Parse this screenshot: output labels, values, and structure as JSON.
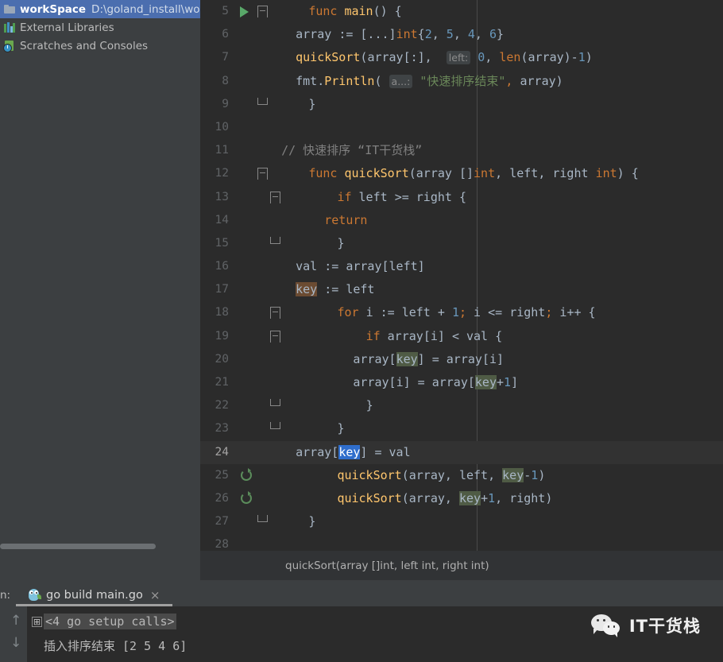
{
  "project_panel": {
    "items": [
      {
        "icon": "folder-icon",
        "label": "workSpace",
        "path": "D:\\goland_install\\wo",
        "selected": true
      },
      {
        "icon": "library-icon",
        "label": "External Libraries",
        "path": "",
        "selected": false
      },
      {
        "icon": "scratches-icon",
        "label": "Scratches and Consoles",
        "path": "",
        "selected": false
      }
    ]
  },
  "editor": {
    "lines": [
      {
        "num": "5",
        "glyph": "run-arrow",
        "fold": "collapse"
      },
      {
        "num": "6",
        "glyph": "",
        "fold": ""
      },
      {
        "num": "7",
        "glyph": "",
        "fold": ""
      },
      {
        "num": "8",
        "glyph": "",
        "fold": ""
      },
      {
        "num": "9",
        "glyph": "",
        "fold": "expand-end"
      },
      {
        "num": "10",
        "glyph": "",
        "fold": ""
      },
      {
        "num": "11",
        "glyph": "",
        "fold": ""
      },
      {
        "num": "12",
        "glyph": "",
        "fold": "collapse"
      },
      {
        "num": "13",
        "glyph": "",
        "fold": "collapse"
      },
      {
        "num": "14",
        "glyph": "",
        "fold": ""
      },
      {
        "num": "15",
        "glyph": "",
        "fold": "expand-end"
      },
      {
        "num": "16",
        "glyph": "",
        "fold": ""
      },
      {
        "num": "17",
        "glyph": "",
        "fold": ""
      },
      {
        "num": "18",
        "glyph": "",
        "fold": "collapse"
      },
      {
        "num": "19",
        "glyph": "",
        "fold": "collapse"
      },
      {
        "num": "20",
        "glyph": "",
        "fold": ""
      },
      {
        "num": "21",
        "glyph": "",
        "fold": ""
      },
      {
        "num": "22",
        "glyph": "",
        "fold": "expand-end"
      },
      {
        "num": "23",
        "glyph": "",
        "fold": "expand-end"
      },
      {
        "num": "24",
        "glyph": "",
        "fold": ""
      },
      {
        "num": "25",
        "glyph": "recursion",
        "fold": ""
      },
      {
        "num": "26",
        "glyph": "recursion",
        "fold": ""
      },
      {
        "num": "27",
        "glyph": "",
        "fold": "expand-end"
      },
      {
        "num": "28",
        "glyph": "",
        "fold": ""
      }
    ],
    "code": {
      "l5": "func main() {",
      "l6": "array := [...]int{2, 5, 4, 6}",
      "l7": "quickSort(array[:],   left: 0, len(array)-1)",
      "l7_hint": "left:",
      "l8": "fmt.Println( a...: \"快速排序结束\", array)",
      "l8_hint": "a...:",
      "l8_str": "\"快速排序结束\"",
      "l9": "}",
      "l11": "// 快速排序 “IT干货栈”",
      "l12": "func quickSort(array []int, left, right int) {",
      "l13": "if left >= right {",
      "l14": "return",
      "l15": "}",
      "l16": "val := array[left]",
      "l17": "key := left",
      "l18": "for i := left + 1; i <= right; i++ {",
      "l19": "if array[i] < val {",
      "l20": "array[key] = array[i]",
      "l21": "array[i] = array[key+1]",
      "l22": "}",
      "l23": "}",
      "l24": "array[key] = val",
      "l25": "quickSort(array, left, key-1)",
      "l26": "quickSort(array, key+1, right)",
      "l27": "}"
    },
    "caret_line": "24",
    "highlight_identifier": "key"
  },
  "breadcrumb": {
    "text": "quickSort(array []int, left int, right int)"
  },
  "run_window": {
    "label": "n:",
    "tab_title": "go build main.go",
    "close_label": "×",
    "nav_up": "↑",
    "nav_down": "↓",
    "expander": "⊞",
    "console": {
      "folded": "<4 go setup calls>",
      "output": "插入排序结束 [2 5 4 6]"
    }
  },
  "watermark": {
    "text": "IT干货栈",
    "icon": "wechat-icon"
  },
  "colors": {
    "keyword": "#cc7832",
    "function": "#ffc66d",
    "number": "#6897bb",
    "string": "#6a8759",
    "comment": "#808080",
    "identifier": "#a9b7c6",
    "selection": "#2f6ecc",
    "write_usage": "#6b4b32",
    "read_usage": "#4f5b45",
    "editor_bg": "#2b2b2b",
    "panel_bg": "#3c3f41",
    "tree_selected": "#4b6eaf",
    "run_arrow": "#59a869"
  }
}
